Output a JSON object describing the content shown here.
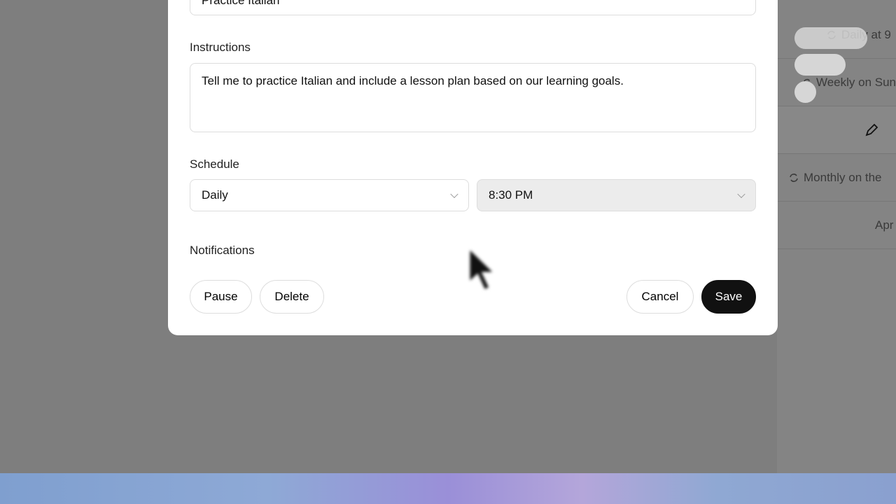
{
  "background_list": {
    "rows": [
      "Daily at 9",
      "Weekly on Sun",
      "Monthly on the",
      "Apr"
    ]
  },
  "modal": {
    "title_value": "Practice Italian",
    "instructions_label": "Instructions",
    "instructions_value": "Tell me to practice Italian and include a lesson plan based on our learning goals.",
    "schedule_label": "Schedule",
    "frequency_value": "Daily",
    "time_value": "8:30 PM",
    "notifications_label": "Notifications",
    "buttons": {
      "pause": "Pause",
      "delete": "Delete",
      "cancel": "Cancel",
      "save": "Save"
    }
  },
  "colors": {
    "save_bg": "#111111",
    "overlay": "#7e7e7e"
  }
}
